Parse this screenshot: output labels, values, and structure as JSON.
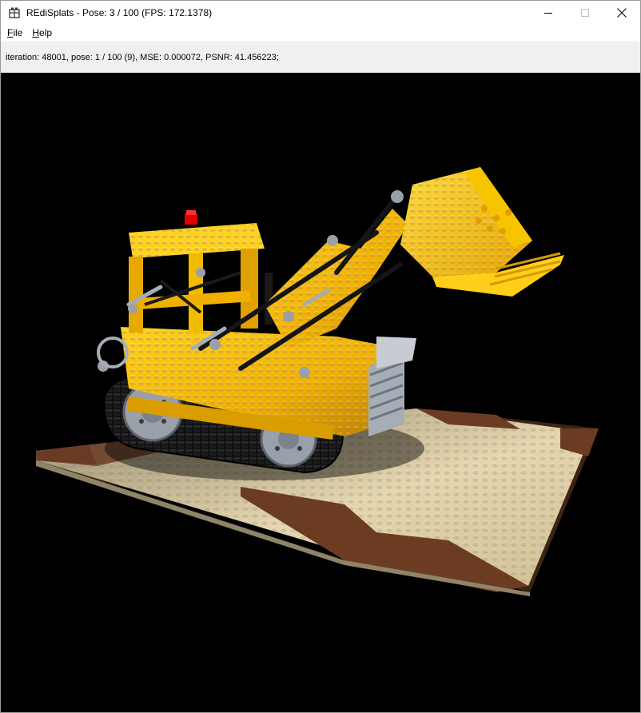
{
  "window": {
    "title": "REdiSplats - Pose: 3 / 100 (FPS: 172.1378)",
    "icon": "app-icon"
  },
  "menu": {
    "file": {
      "accel": "F",
      "rest": "ile"
    },
    "help": {
      "accel": "H",
      "rest": "elp"
    }
  },
  "status": {
    "text": "iteration: 48001, pose: 1 / 100 (9), MSE: 0.000072, PSNR: 41.456223;"
  },
  "viewport": {
    "content": "3D render of a yellow LEGO Technic crawler loader on a baseplate",
    "background": "#000000",
    "colors": {
      "yellow": "#f2b705",
      "tan": "#d9c79a",
      "brown": "#6b3b22",
      "gray": "#9aa0aa",
      "black": "#141414",
      "red": "#d40000"
    }
  }
}
